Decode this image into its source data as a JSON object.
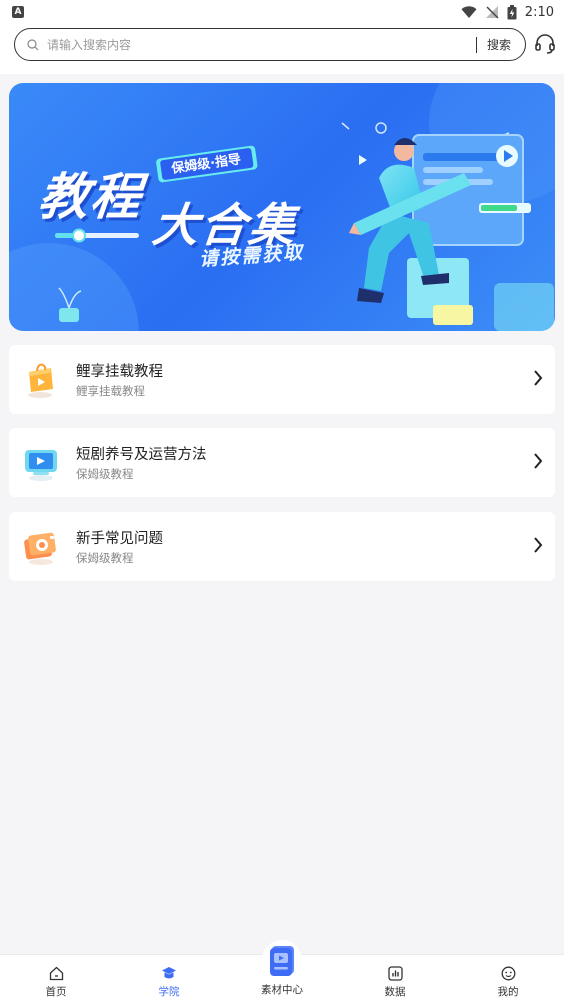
{
  "status_bar": {
    "time": "2:10",
    "left_badge": "A"
  },
  "search": {
    "placeholder": "请输入搜索内容",
    "button_label": "搜索"
  },
  "banner": {
    "headline_line1": "教程",
    "headline_line2": "大合集",
    "tag": "保姆级·指导",
    "subline": "请按需获取"
  },
  "items": [
    {
      "title": "鲤享挂载教程",
      "subtitle": "鲤享挂载教程",
      "icon": "orange-bag-icon"
    },
    {
      "title": "短剧养号及运营方法",
      "subtitle": "保姆级教程",
      "icon": "tv-play-icon"
    },
    {
      "title": "新手常见问题",
      "subtitle": "保姆级教程",
      "icon": "camera-question-icon"
    }
  ],
  "nav": {
    "home": "首页",
    "academy": "学院",
    "materials": "素材中心",
    "data": "数据",
    "mine": "我的"
  },
  "colors": {
    "accent": "#3f6cf5",
    "banner_blue": "#2a6ef2"
  }
}
